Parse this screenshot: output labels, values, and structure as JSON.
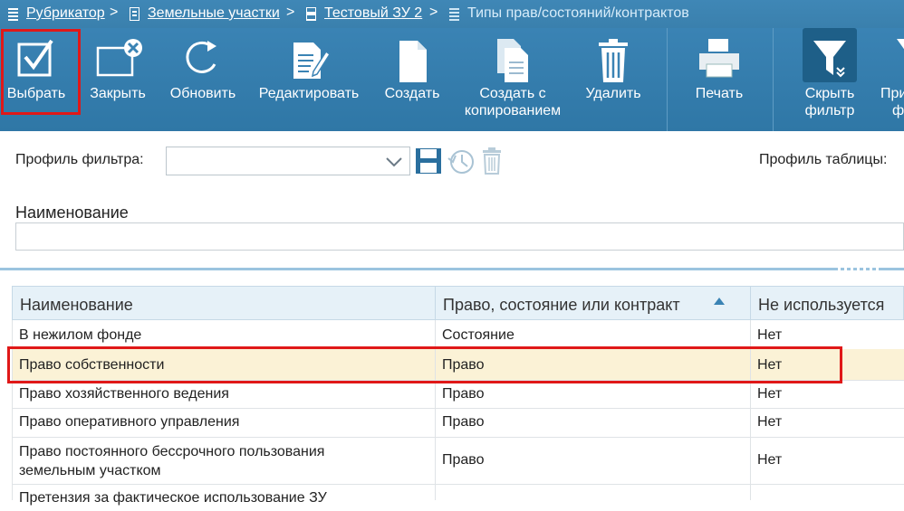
{
  "breadcrumb": {
    "items": [
      "Рубрикатор",
      "Земельные участки",
      "Тестовый ЗУ 2"
    ],
    "current": "Типы прав/состояний/контрактов",
    "separator": ">"
  },
  "toolbar": {
    "select": "Выбрать",
    "close": "Закрыть",
    "refresh": "Обновить",
    "edit": "Редактировать",
    "create": "Создать",
    "copy_line1": "Создать с",
    "copy_line2": "копированием",
    "delete": "Удалить",
    "print": "Печать",
    "hide_filter_line1": "Скрыть",
    "hide_filter_line2": "фильтр",
    "apply_line1": "При",
    "apply_line2": "ф"
  },
  "filter": {
    "profile_label": "Профиль фильтра:",
    "profile_value": "",
    "table_profile_label": "Профиль таблицы:",
    "name_label": "Наименование",
    "name_value": ""
  },
  "table": {
    "headers": [
      "Наименование",
      "Право, состояние или контракт",
      "Не используется"
    ],
    "sorted_column": 1,
    "sort_direction": "asc",
    "rows": [
      {
        "name": "В нежилом фонде",
        "type": "Состояние",
        "unused": "Нет"
      },
      {
        "name": "Право собственности",
        "type": "Право",
        "unused": "Нет"
      },
      {
        "name": "Право хозяйственного ведения",
        "type": "Право",
        "unused": "Нет"
      },
      {
        "name": "Право оперативного управления",
        "type": "Право",
        "unused": "Нет"
      },
      {
        "name_line1": "Право постоянного бессрочного пользования",
        "name_line2": "земельным участком",
        "type": "Право",
        "unused": "Нет"
      },
      {
        "name": "Претензия за фактическое использование ЗУ",
        "type": "",
        "unused": ""
      }
    ],
    "selected_row": 1
  },
  "colors": {
    "toolbar": "#3a83b4",
    "highlight": "#e01818",
    "selected_row": "#fbf2d6",
    "header": "#e6f1f8"
  }
}
